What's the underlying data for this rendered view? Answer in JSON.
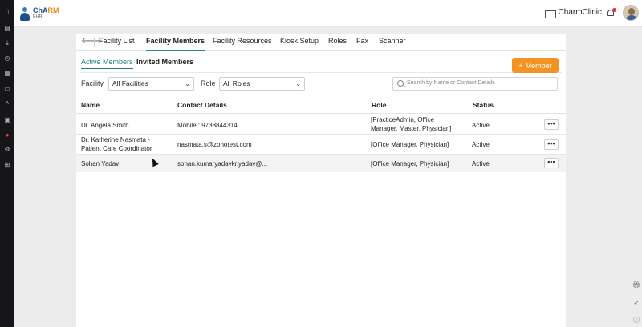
{
  "brand": {
    "name_main": "ChA",
    "name_accent": "RM",
    "sub": "EHR"
  },
  "header": {
    "clinic_name": "CharmClinic"
  },
  "tabs": [
    {
      "label": "Facility List"
    },
    {
      "label": "Facility Members"
    },
    {
      "label": "Facility Resources"
    },
    {
      "label": "Kiosk Setup"
    },
    {
      "label": "Roles"
    },
    {
      "label": "Fax"
    },
    {
      "label": "Scanner"
    }
  ],
  "subtabs": {
    "active": "Active Members",
    "invited": "Invited Members"
  },
  "add_button": {
    "label": "Member"
  },
  "filters": {
    "facility_label": "Facility",
    "facility_value": "All Facilities",
    "role_label": "Role",
    "role_value": "All Roles",
    "search_placeholder": "Search by Name or Contact Details"
  },
  "table": {
    "headers": {
      "name": "Name",
      "contact": "Contact Details",
      "role": "Role",
      "status": "Status"
    },
    "rows": [
      {
        "name": [
          "Dr. Angela Smith"
        ],
        "contact": "Mobile : 9738844314",
        "role": [
          "[PracticeAdmin, Office",
          "Manager, Master, Physician]"
        ],
        "status": "Active",
        "more": "•••"
      },
      {
        "name": [
          "Dr. Katherine Nasmata -",
          "Patient Care Coordinator"
        ],
        "contact": "nasmata.s@zohotest.com",
        "role": [
          "[Office Manager, Physician]"
        ],
        "status": "Active",
        "more": "•••"
      },
      {
        "name": [
          "Sohan Yadav"
        ],
        "contact": "sohan.kumaryadavkr.yadav@...",
        "role": [
          "[Office Manager, Physician]"
        ],
        "status": "Active",
        "more": "•••"
      }
    ]
  },
  "colors": {
    "accent_teal": "#1a7f78",
    "button_orange": "#f39323"
  }
}
